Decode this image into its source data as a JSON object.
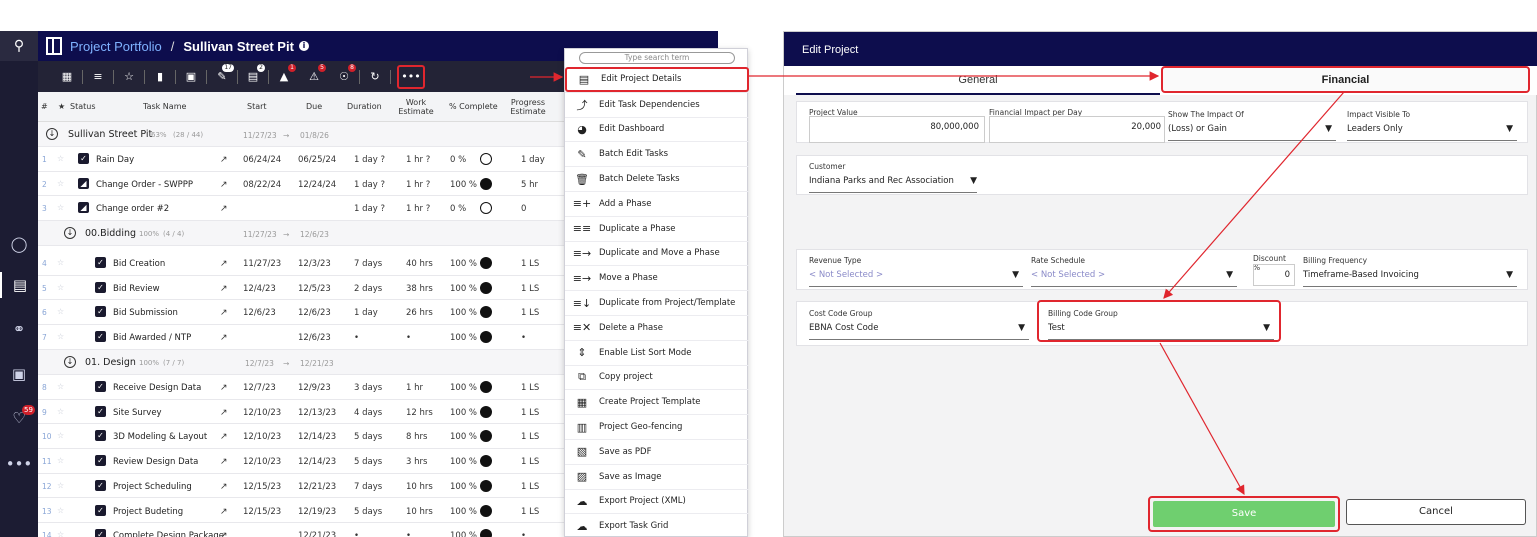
{
  "header": {
    "portfolio": "Project Portfolio",
    "separator": "/",
    "project": "Sullivan Street Pit",
    "info_icon": "info-icon"
  },
  "rail": {
    "search_icon": "search-icon",
    "notifications_badge": "59"
  },
  "toolbar": {
    "badges": {
      "comments": "17",
      "docs": "2",
      "alerts": "1",
      "issues": "5",
      "risks": "8"
    },
    "more_label": "•••"
  },
  "table": {
    "columns": {
      "num": "#",
      "star": "★",
      "status": "Status",
      "task_name": "Task Name",
      "start": "Start",
      "due": "Due",
      "duration": "Duration",
      "work_estimate": "Work Estimate",
      "pct_complete": "% Complete",
      "progress_estimate": "Progress Estimate"
    },
    "project_row": {
      "name": "Sullivan Street Pit",
      "pct": "63%",
      "count": "(28 / 44)",
      "start": "11/27/23",
      "arrow": "→",
      "end": "01/8/26"
    },
    "rows": [
      {
        "num": "1",
        "name": "Rain Day",
        "start": "06/24/24",
        "due": "06/25/24",
        "duration": "1 day ?",
        "work": "1 hr ?",
        "pct": "0 %",
        "done": false,
        "progress": "1 day"
      },
      {
        "num": "2",
        "name": "Change Order - SWPPP",
        "start": "08/22/24",
        "due": "12/24/24",
        "duration": "1 day ?",
        "work": "1 hr ?",
        "pct": "100 %",
        "done": true,
        "progress": "5 hr"
      },
      {
        "num": "3",
        "name": "Change order #2",
        "start": "",
        "due": "",
        "duration": "1 day ?",
        "work": "1 hr ?",
        "pct": "0 %",
        "done": false,
        "progress": "0"
      }
    ],
    "phase_bidding": {
      "name": "00.Bidding",
      "pct": "100%",
      "count": "(4 / 4)",
      "start": "11/27/23",
      "arrow": "→",
      "end": "12/6/23"
    },
    "bidding_rows": [
      {
        "num": "4",
        "name": "Bid Creation",
        "start": "11/27/23",
        "due": "12/3/23",
        "duration": "7 days",
        "work": "40 hrs",
        "pct": "100 %",
        "progress": "1 LS"
      },
      {
        "num": "5",
        "name": "Bid Review",
        "start": "12/4/23",
        "due": "12/5/23",
        "duration": "2 days",
        "work": "38 hrs",
        "pct": "100 %",
        "progress": "1 LS"
      },
      {
        "num": "6",
        "name": "Bid Submission",
        "start": "12/6/23",
        "due": "12/6/23",
        "duration": "1 day",
        "work": "26 hrs",
        "pct": "100 %",
        "progress": "1 LS"
      },
      {
        "num": "7",
        "name": "Bid Awarded / NTP",
        "start": "",
        "due": "12/6/23",
        "duration": "•",
        "work": "•",
        "pct": "100 %",
        "progress": "•"
      }
    ],
    "phase_design": {
      "name": "01. Design",
      "pct": "100%",
      "count": "(7 / 7)",
      "start": "12/7/23",
      "arrow": "→",
      "end": "12/21/23"
    },
    "design_rows": [
      {
        "num": "8",
        "name": "Receive Design Data",
        "start": "12/7/23",
        "due": "12/9/23",
        "duration": "3 days",
        "work": "1 hr",
        "pct": "100 %",
        "progress": "1 LS"
      },
      {
        "num": "9",
        "name": "Site Survey",
        "start": "12/10/23",
        "due": "12/13/23",
        "duration": "4 days",
        "work": "12 hrs",
        "pct": "100 %",
        "progress": "1 LS"
      },
      {
        "num": "10",
        "name": "3D Modeling & Layout",
        "start": "12/10/23",
        "due": "12/14/23",
        "duration": "5 days",
        "work": "8 hrs",
        "pct": "100 %",
        "progress": "1 LS"
      },
      {
        "num": "11",
        "name": "Review Design Data",
        "start": "12/10/23",
        "due": "12/14/23",
        "duration": "5 days",
        "work": "3 hrs",
        "pct": "100 %",
        "progress": "1 LS"
      },
      {
        "num": "12",
        "name": "Project Scheduling",
        "start": "12/15/23",
        "due": "12/21/23",
        "duration": "7 days",
        "work": "10 hrs",
        "pct": "100 %",
        "progress": "1 LS"
      },
      {
        "num": "13",
        "name": "Project Budeting",
        "start": "12/15/23",
        "due": "12/19/23",
        "duration": "5 days",
        "work": "10 hrs",
        "pct": "100 %",
        "progress": "1 LS"
      },
      {
        "num": "14",
        "name": "Complete Design Package",
        "start": "",
        "due": "12/21/23",
        "duration": "•",
        "work": "•",
        "pct": "100 %",
        "progress": "•"
      }
    ]
  },
  "menu": {
    "search_placeholder": "Type search term",
    "items": [
      {
        "label": "Edit Project Details",
        "icon": "panel-icon"
      },
      {
        "label": "Edit Task Dependencies",
        "icon": "dependency-icon"
      },
      {
        "label": "Edit Dashboard",
        "icon": "pie-chart-icon"
      },
      {
        "label": "Batch Edit Tasks",
        "icon": "batch-edit-icon"
      },
      {
        "label": "Batch Delete Tasks",
        "icon": "batch-delete-icon"
      },
      {
        "label": "Add a Phase",
        "icon": "add-phase-icon"
      },
      {
        "label": "Duplicate a Phase",
        "icon": "duplicate-phase-icon"
      },
      {
        "label": "Duplicate and Move a Phase",
        "icon": "duplicate-move-icon"
      },
      {
        "label": "Move a Phase",
        "icon": "move-phase-icon"
      },
      {
        "label": "Duplicate from Project/Template",
        "icon": "duplicate-template-icon"
      },
      {
        "label": "Delete a Phase",
        "icon": "delete-phase-icon"
      },
      {
        "label": "Enable List Sort Mode",
        "icon": "sort-icon"
      },
      {
        "label": "Copy project",
        "icon": "copy-icon"
      },
      {
        "label": "Create Project Template",
        "icon": "template-icon"
      },
      {
        "label": "Project Geo-fencing",
        "icon": "map-icon"
      },
      {
        "label": "Save as PDF",
        "icon": "pdf-icon"
      },
      {
        "label": "Save as Image",
        "icon": "image-icon"
      },
      {
        "label": "Export Project (XML)",
        "icon": "cloud-export-icon"
      },
      {
        "label": "Export Task Grid",
        "icon": "cloud-export-icon"
      }
    ]
  },
  "panel": {
    "title": "Edit Project",
    "tab_general": "General",
    "tab_financial": "Financial",
    "project_value_label": "Project Value",
    "project_value": "80,000,000",
    "fin_impact_label": "Financial Impact per Day",
    "fin_impact": "20,000",
    "show_impact_label": "Show The Impact Of",
    "show_impact": "(Loss) or Gain",
    "impact_visible_label": "Impact Visible To",
    "impact_visible": "Leaders Only",
    "customer_label": "Customer",
    "customer": "Indiana Parks and Rec Association",
    "revenue_type_label": "Revenue Type",
    "revenue_type": "< Not Selected >",
    "rate_schedule_label": "Rate Schedule",
    "rate_schedule": "< Not Selected >",
    "discount_label": "Discount %",
    "discount": "0",
    "billing_freq_label": "Billing Frequency",
    "billing_freq": "Timeframe-Based Invoicing",
    "cost_code_label": "Cost Code Group",
    "cost_code": "EBNA Cost Code",
    "billing_code_label": "Billing Code Group",
    "billing_code": "Test",
    "save": "Save",
    "cancel": "Cancel"
  },
  "colors": {
    "navy": "#0d0d4d",
    "highlight": "#e0262e",
    "save_green": "#6fcf6f"
  }
}
